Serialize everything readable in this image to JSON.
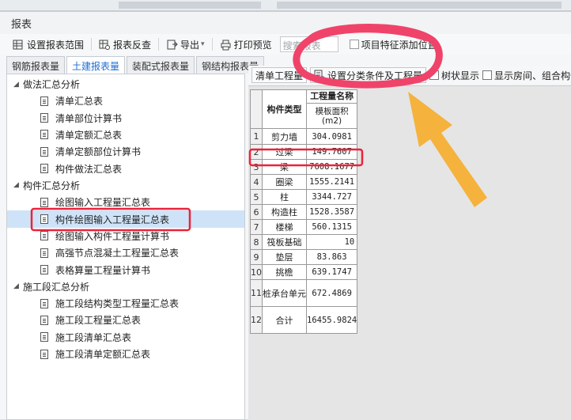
{
  "window": {
    "title": "报表"
  },
  "toolbar": {
    "set_range": "设置报表范围",
    "check": "报表反查",
    "export": "导出",
    "print_preview": "打印预览",
    "search_placeholder": "搜索报表",
    "feature_add": "项目特征添加位置"
  },
  "tabs": [
    "钢筋报表量",
    "土建报表量",
    "装配式报表量",
    "钢结构报表量"
  ],
  "tree": {
    "groups": [
      {
        "label": "做法汇总分析",
        "items": [
          "清单汇总表",
          "清单部位计算书",
          "清单定额汇总表",
          "清单定额部位计算书",
          "构件做法汇总表"
        ]
      },
      {
        "label": "构件汇总分析",
        "items": [
          "绘图输入工程量汇总表",
          "构件绘图输入工程量汇总表",
          "绘图输入构件工程量计算书",
          "高强节点混凝土工程量汇总表",
          "表格算量工程量计算书"
        ]
      },
      {
        "label": "施工段汇总分析",
        "items": [
          "施工段结构类型工程量汇总表",
          "施工段工程量汇总表",
          "施工段清单汇总表",
          "施工段清单定额汇总表"
        ]
      }
    ]
  },
  "subtoolbar": {
    "btn1": "清单工程量",
    "btn2": "设置分类条件及工程量",
    "chk1": "树状显示",
    "chk2": "显示房间、组合构件量"
  },
  "table": {
    "header_col1": "构件类型",
    "header_col2_top": "工程量名称",
    "header_col2_sub": "模板面积(m2)",
    "rows": [
      {
        "n": "1",
        "type": "剪力墙",
        "val": "304.0981"
      },
      {
        "n": "2",
        "type": "过梁",
        "val": "149.7607"
      },
      {
        "n": "3",
        "type": "梁",
        "val": "7608.1677"
      },
      {
        "n": "4",
        "type": "圈梁",
        "val": "1555.2141"
      },
      {
        "n": "5",
        "type": "柱",
        "val": "3344.727"
      },
      {
        "n": "6",
        "type": "构造柱",
        "val": "1528.3587"
      },
      {
        "n": "7",
        "type": "楼梯",
        "val": "560.1315"
      },
      {
        "n": "8",
        "type": "筏板基础",
        "val": "10"
      },
      {
        "n": "9",
        "type": "垫层",
        "val": "83.863"
      },
      {
        "n": "10",
        "type": "挑檐",
        "val": "639.1747"
      },
      {
        "n": "11",
        "type": "桩承台单元",
        "val": "672.4869"
      },
      {
        "n": "12",
        "type": "合计",
        "val": "16455.9824"
      }
    ]
  },
  "colors": {
    "accent": "#1f6fd6",
    "annotation_red": "#e8243a",
    "annotation_pink": "#f0436a",
    "arrow": "#f5b23c"
  }
}
